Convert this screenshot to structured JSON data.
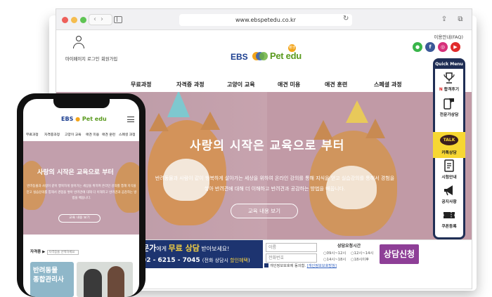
{
  "browser": {
    "url": "www.ebspetedu.co.kr"
  },
  "header": {
    "faq": "이용안내(FAQ)",
    "util_links": [
      "마이페이지",
      "로그인",
      "회원가입"
    ],
    "logo_ebs": "EBS",
    "logo_pet": "Pet edu",
    "logo_badge": "평생"
  },
  "nav": [
    "무료과정",
    "자격증 과정",
    "고양이 교육",
    "애견 미용",
    "애견 훈련",
    "스페셜 과정"
  ],
  "hero": {
    "title": "사랑의 시작은 교육으로 부터",
    "sub1": "반려동물과 사람이 같이 행복하게 살아가는 세상을 위하여 온라인 강의를 통해 지식을 얻고 실습강의를 통해서 경험을",
    "sub2": "쌓아 반려견에 대해 더 이해하고 반려견과 공감하는 방법을 배웁니다.",
    "button": "교육 내용 보기"
  },
  "quick_menu": {
    "title": "Quick Menu",
    "items": [
      "합격후기",
      "전문가상담",
      "카톡상담",
      "시험안내",
      "공지사항",
      "쿠폰등록"
    ],
    "talk_badge": "TALK"
  },
  "banner": {
    "line1_a": "문가",
    "line1_b": "에게 ",
    "line1_c": "무료 상담",
    "line1_d": " 받아보세요!",
    "phone": "02 - 6215 - 7045",
    "phone_note_a": "(전화 상담시 ",
    "phone_note_b": "할인혜택",
    "phone_note_c": ")",
    "name_placeholder": "이름",
    "phone_placeholder": "전화번호",
    "time_title": "상담요청시간",
    "time_options": [
      "09시~12시",
      "12시~14시",
      "14시~18시",
      "18시이후"
    ],
    "agree": "개인정보보호에 동의함.",
    "agree_link": "[개인정보보호방침]",
    "apply": "상담신청"
  },
  "mobile": {
    "logo_ebs": "EBS",
    "logo_pet": "Pet edu",
    "nav": [
      "무료과정",
      "자격증과정",
      "고양이 교육",
      "애견 미용",
      "애견 훈련",
      "스페셜 과정"
    ],
    "hero_title": "사랑의 시작은 교육으로 부터",
    "hero_sub": "반려동물과 사람이 같이 행복하게 살아가는 세상을 위하여 온라인 강의를 통해 지식을 얻고 실습강의를 통해서 경험을 쌓아 반려견에 대해 더 이해하고 반려견과 공감하는 방법을 배웁니다.",
    "hero_button": "교육 내용 보기",
    "qual_label": "자격증 ▶",
    "qual_select": "자격증을 선택하세요",
    "card_title_1": "반려동물",
    "card_title_2": "종합관리사"
  }
}
